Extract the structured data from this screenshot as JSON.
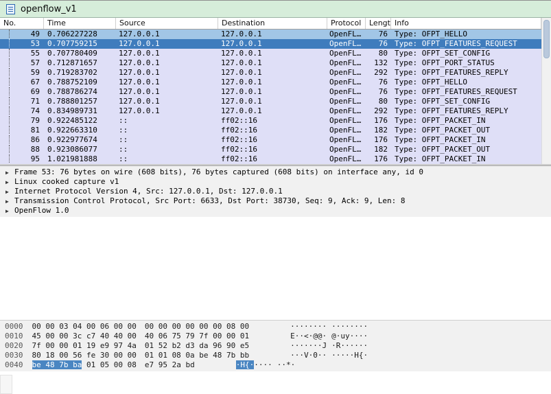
{
  "window": {
    "title": "openflow_v1"
  },
  "icons": {
    "expand_arrow": "▶"
  },
  "colors": {
    "titlebar": "#d6edda",
    "packet_row": "#dfdff7",
    "related_row": "#a2c6e6",
    "selected_row": "#3f7cbd",
    "hex_selection": "#4a86c2"
  },
  "packet_list": {
    "columns": [
      "No.",
      "Time",
      "Source",
      "Destination",
      "Protocol",
      "Length",
      "Info"
    ],
    "selected_no": "53",
    "rows": [
      {
        "no": "49",
        "time": "0.706227228",
        "source": "127.0.0.1",
        "destination": "127.0.0.1",
        "protocol": "OpenFL…",
        "length": "76",
        "info": "Type: OFPT_HELLO"
      },
      {
        "no": "53",
        "time": "0.707759215",
        "source": "127.0.0.1",
        "destination": "127.0.0.1",
        "protocol": "OpenFL…",
        "length": "76",
        "info": "Type: OFPT_FEATURES_REQUEST"
      },
      {
        "no": "55",
        "time": "0.707780409",
        "source": "127.0.0.1",
        "destination": "127.0.0.1",
        "protocol": "OpenFL…",
        "length": "80",
        "info": "Type: OFPT_SET_CONFIG"
      },
      {
        "no": "57",
        "time": "0.712871657",
        "source": "127.0.0.1",
        "destination": "127.0.0.1",
        "protocol": "OpenFL…",
        "length": "132",
        "info": "Type: OFPT_PORT_STATUS"
      },
      {
        "no": "59",
        "time": "0.719283702",
        "source": "127.0.0.1",
        "destination": "127.0.0.1",
        "protocol": "OpenFL…",
        "length": "292",
        "info": "Type: OFPT_FEATURES_REPLY"
      },
      {
        "no": "67",
        "time": "0.788752109",
        "source": "127.0.0.1",
        "destination": "127.0.0.1",
        "protocol": "OpenFL…",
        "length": "76",
        "info": "Type: OFPT_HELLO"
      },
      {
        "no": "69",
        "time": "0.788786274",
        "source": "127.0.0.1",
        "destination": "127.0.0.1",
        "protocol": "OpenFL…",
        "length": "76",
        "info": "Type: OFPT_FEATURES_REQUEST"
      },
      {
        "no": "71",
        "time": "0.788801257",
        "source": "127.0.0.1",
        "destination": "127.0.0.1",
        "protocol": "OpenFL…",
        "length": "80",
        "info": "Type: OFPT_SET_CONFIG"
      },
      {
        "no": "74",
        "time": "0.834989731",
        "source": "127.0.0.1",
        "destination": "127.0.0.1",
        "protocol": "OpenFL…",
        "length": "292",
        "info": "Type: OFPT_FEATURES_REPLY"
      },
      {
        "no": "79",
        "time": "0.922485122",
        "source": "::",
        "destination": "ff02::16",
        "protocol": "OpenFL…",
        "length": "176",
        "info": "Type: OFPT_PACKET_IN"
      },
      {
        "no": "81",
        "time": "0.922663310",
        "source": "::",
        "destination": "ff02::16",
        "protocol": "OpenFL…",
        "length": "182",
        "info": "Type: OFPT_PACKET_OUT"
      },
      {
        "no": "86",
        "time": "0.922977674",
        "source": "::",
        "destination": "ff02::16",
        "protocol": "OpenFL…",
        "length": "176",
        "info": "Type: OFPT_PACKET_IN"
      },
      {
        "no": "88",
        "time": "0.923086077",
        "source": "::",
        "destination": "ff02::16",
        "protocol": "OpenFL…",
        "length": "182",
        "info": "Type: OFPT_PACKET_OUT"
      },
      {
        "no": "95",
        "time": "1.021981888",
        "source": "::",
        "destination": "ff02::16",
        "protocol": "OpenFL…",
        "length": "176",
        "info": "Type: OFPT_PACKET_IN"
      }
    ]
  },
  "details": {
    "lines": [
      "Frame 53: 76 bytes on wire (608 bits), 76 bytes captured (608 bits) on interface any, id 0",
      "Linux cooked capture v1",
      "Internet Protocol Version 4, Src: 127.0.0.1, Dst: 127.0.0.1",
      "Transmission Control Protocol, Src Port: 6633, Dst Port: 38730, Seq: 9, Ack: 9, Len: 8",
      "OpenFlow 1.0"
    ]
  },
  "hex": {
    "rows": [
      {
        "offset": "0000",
        "h1sel": "",
        "h1": "00 00 03 04 00 06 00 00",
        "h2": "00 00 00 00 00 00 08 00",
        "a1sel": "",
        "a1": "········",
        "a2": "········"
      },
      {
        "offset": "0010",
        "h1sel": "",
        "h1": "45 00 00 3c c7 40 40 00",
        "h2": "40 06 75 79 7f 00 00 01",
        "a1sel": "",
        "a1": "E··<·@@·",
        "a2": "@·uy····"
      },
      {
        "offset": "0020",
        "h1sel": "",
        "h1": "7f 00 00 01 19 e9 97 4a",
        "h2": "01 52 b2 d3 da 96 90 e5",
        "a1sel": "",
        "a1": "·······J",
        "a2": "·R······"
      },
      {
        "offset": "0030",
        "h1sel": "",
        "h1": "80 18 00 56 fe 30 00 00",
        "h2": "01 01 08 0a be 48 7b bb",
        "a1sel": "",
        "a1": "···V·0··",
        "a2": "·····H{·"
      },
      {
        "offset": "0040",
        "h1sel": "be 48 7b ba",
        "h1": " 01 05 00 08",
        "h2": "e7 95 2a bd",
        "a1sel": "·H{·",
        "a1": "····",
        "a2": "··*·"
      }
    ]
  }
}
